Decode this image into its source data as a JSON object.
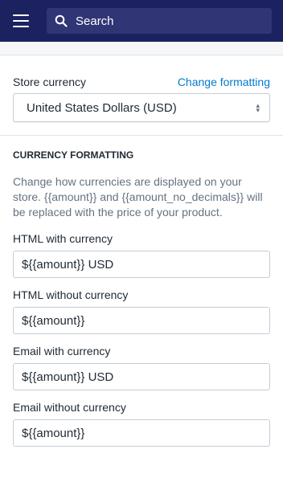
{
  "header": {
    "search_placeholder": "Search",
    "brand_color": "#1c2260"
  },
  "store_currency": {
    "label": "Store currency",
    "change_link": "Change formatting",
    "selected": "United States Dollars (USD)"
  },
  "formatting": {
    "heading": "CURRENCY FORMATTING",
    "description": "Change how currencies are displayed on your store. {{amount}} and {{amount_no_decimals}} will be replaced with the price of your product.",
    "fields": [
      {
        "label": "HTML with currency",
        "value": "${{amount}} USD"
      },
      {
        "label": "HTML without currency",
        "value": "${{amount}}"
      },
      {
        "label": "Email with currency",
        "value": "${{amount}} USD"
      },
      {
        "label": "Email without currency",
        "value": "${{amount}}"
      }
    ]
  }
}
